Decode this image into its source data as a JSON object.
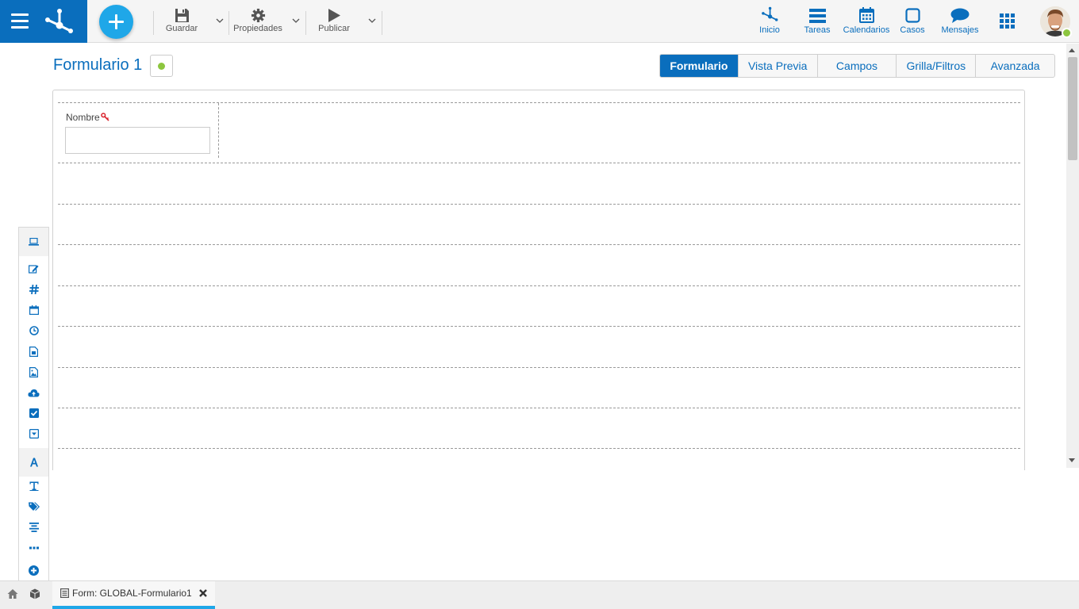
{
  "toolbar": {
    "save_label": "Guardar",
    "properties_label": "Propiedades",
    "publish_label": "Publicar"
  },
  "nav": {
    "inicio": "Inicio",
    "tareas": "Tareas",
    "calendarios": "Calendarios",
    "casos": "Casos",
    "mensajes": "Mensajes"
  },
  "page": {
    "title": "Formulario 1"
  },
  "tabs": [
    {
      "label": "Formulario",
      "active": true
    },
    {
      "label": "Vista Previa",
      "active": false
    },
    {
      "label": "Campos",
      "active": false
    },
    {
      "label": "Grilla/Filtros",
      "active": false
    },
    {
      "label": "Avanzada",
      "active": false
    }
  ],
  "form": {
    "field_label": "Nombre",
    "field_value": ""
  },
  "bottom": {
    "doc_tab_label": "Form: GLOBAL-Formulario1"
  },
  "colors": {
    "brand": "#0a6ebd",
    "accent": "#1fa7e8",
    "status": "#8dc63f",
    "required_key": "#d9232d"
  },
  "icons": {
    "palette": [
      "laptop-icon",
      "edit-icon",
      "hash-icon",
      "calendar-icon",
      "clock-icon",
      "file-icon",
      "image-icon",
      "cloud-upload-icon",
      "checkbox-icon",
      "dropdown-icon",
      "font-icon",
      "text-icon",
      "tags-icon",
      "align-center-icon",
      "ellipsis-icon",
      "plus-circle-icon"
    ]
  }
}
